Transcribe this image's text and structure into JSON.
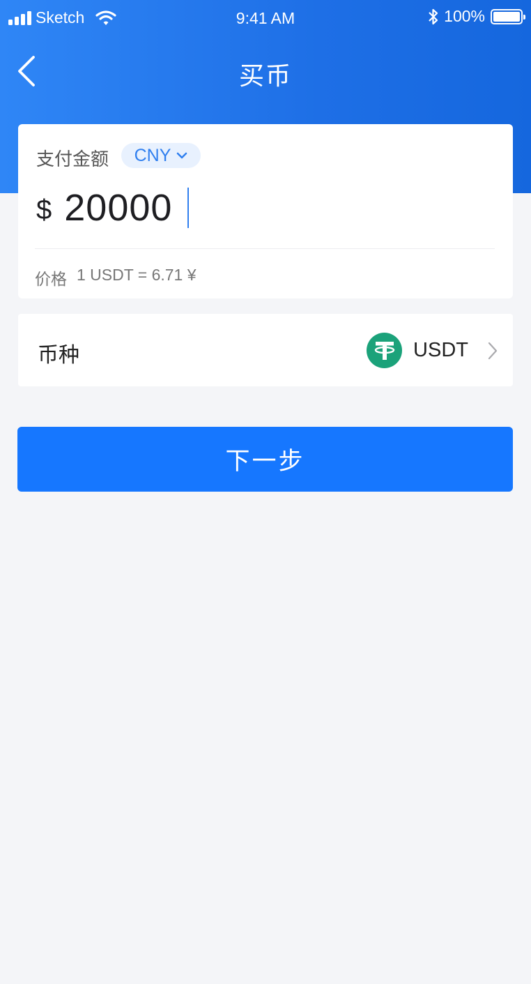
{
  "status_bar": {
    "carrier": "Sketch",
    "time": "9:41 AM",
    "battery": "100%"
  },
  "nav": {
    "title": "买币"
  },
  "amount_card": {
    "label": "支付金额",
    "currency": "CNY",
    "currency_symbol": "$",
    "amount": "20000",
    "price_label": "价格",
    "price_value": "1 USDT = 6.71 ¥"
  },
  "coin": {
    "label": "币种",
    "selected": "USDT"
  },
  "next_button": {
    "label": "下一步"
  },
  "colors": {
    "header_gradient_start": "#2f86f6",
    "header_gradient_end": "#1567de",
    "primary_button": "#1677ff",
    "tether_green": "#1ba27a",
    "page_background": "#f4f5f8"
  }
}
